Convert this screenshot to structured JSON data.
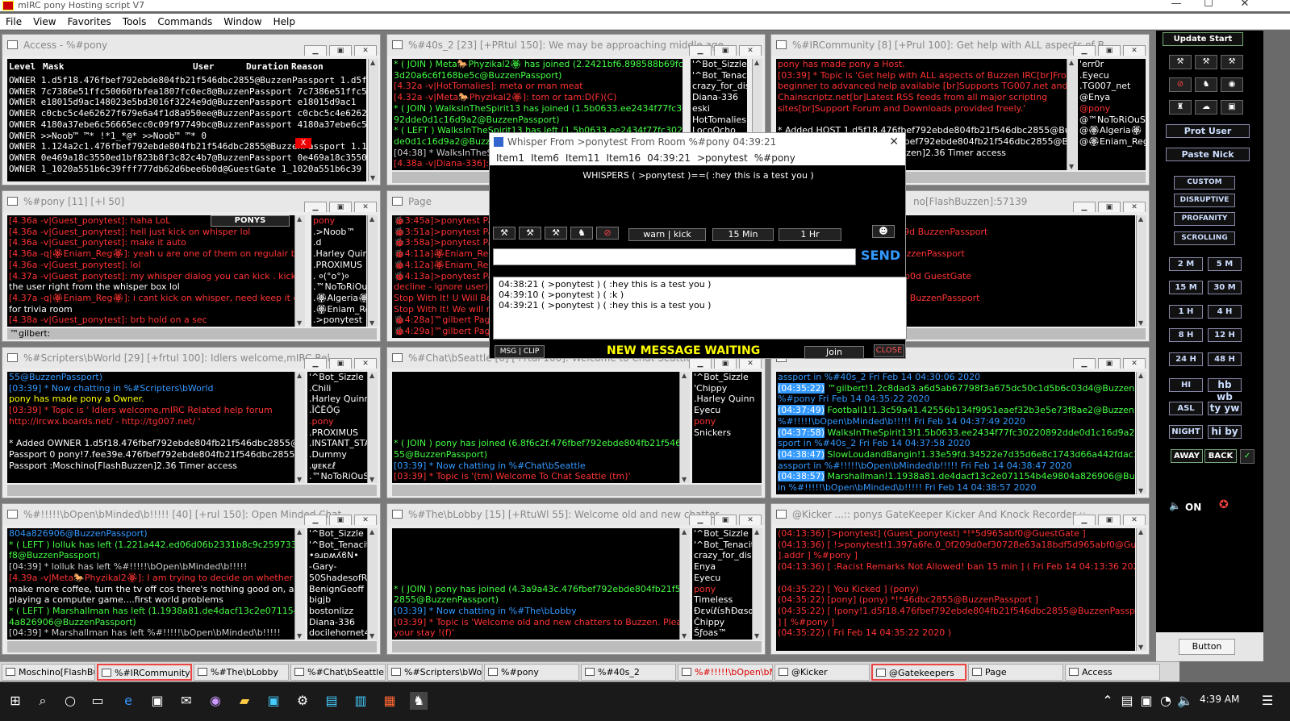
{
  "app": {
    "title": "mIRC pony Hosting script V7",
    "wc_min": "—",
    "wc_max": "☐",
    "wc_close": "✕"
  },
  "menu": [
    "File",
    "View",
    "Favorites",
    "Tools",
    "Commands",
    "Window",
    "Help"
  ],
  "access": {
    "title": "Access - %#pony",
    "headers": [
      "Level",
      "Mask",
      "User",
      "Duration",
      "Reason"
    ],
    "rows": [
      "OWNER  1.d5f18.476fbef792ebde804fb21f546dbc2855@BuzzenPassport 1.d5f18",
      "OWNER  7c7386e51ffc50060fbfea1807fc0ec8@BuzzenPassport 7c7386e51ffc50",
      "OWNER  e18015d9ac148023e5bd3016f3224e9d@BuzzenPassport e18015d9ac1",
      "OWNER  c0cbc5c4e62627f679e6a4f1d8a950ee@BuzzenPassport c0cbc5c4e62627",
      "OWNER  4180a37ebe6c56665ecc0c09f97749bc@BuzzenPassport 4180a37ebe6c5",
      "OWNER  >>Noob™     ™*  !*1_*@*       >>Noob™     ™*    0",
      "OWNER  1.124a2c1.476fbef792ebde804fb21f546dbc2855@BuzzenPassport 1.12",
      "OWNER  0e469a18c3550ed1bf823b8f3c82c4b7@BuzzenPassport 0e469a18c3550",
      "OWNER  1_1020a551b6c39fff777db62d6bee6b0d@GuestGate 1_1020a551b6c39"
    ],
    "x_badge": "X"
  },
  "w40s": {
    "title": "%#40s_2 [23] [+PRtul 150]: We may be approaching middle age...",
    "lines": [
      [
        "cg",
        "* ( JOIN ) Meta🐎Phyzikal2🏵 has joined (2.2421bf6.898588b69fc06fc3"
      ],
      [
        "cg",
        "3d20a6c6f168be5c@BuzzenPassport)"
      ],
      [
        "cr",
        "[4.32a -v|HotTomalies]: meta or man meat"
      ],
      [
        "cr",
        "[4.32a -v|Meta🐎Phyzikal2🏵]: tom or tam:D(F)(C)"
      ],
      [
        "cg",
        "* ( JOIN ) WalksInTheSpirit13 has joined (1.5b0633.ee2434f77fc302208"
      ],
      [
        "cg",
        "92dde0d1c16d9a2@BuzzenPassport)"
      ],
      [
        "cg",
        "* ( LEFT ) WalksInTheSpirit13 has left (1.5b0633.ee2434f77fc30220892"
      ],
      [
        "cg",
        "de0d1c16d9a2@BuzzenPassport)"
      ],
      [
        "cn",
        "[04:38] * WalksInTheSpi"
      ],
      [
        "cr",
        "[4.38a -v|Diana-336]: gi"
      ]
    ],
    "nicks": [
      "'^Bot_Sizzle",
      "'^Bot_Tenacity",
      "crazy_for_disn",
      "Diana-336",
      "eski",
      "HotTomalies",
      "LocoOcho"
    ]
  },
  "community": {
    "title": "%#IRCommunity [8] [+Prul 100]: Get help with ALL aspects of B...",
    "lines": [
      [
        "cr",
        "pony has made pony a Host."
      ],
      [
        "cr",
        "[03:39] * Topic is 'Get help with ALL aspects of Buzzen IRC[br]From"
      ],
      [
        "cr",
        "  beginner to advanced help available [br]Supports TG007.net and"
      ],
      [
        "cr",
        "  Chainscriptz.net[br]Latest RSS feeds from all major scripting"
      ],
      [
        "cr",
        "  sites[br]Support Forum and Downloads provided freely.'"
      ],
      [
        "cw",
        ""
      ],
      [
        "cw",
        "* Added HOST 1.d5f18.476fbef792ebde804fb21f546dbc2855@BuzzenPa"
      ],
      [
        "cw",
        "  ssport 0 pony!7.fee39e.476fbef792ebde804fb21f546dbc2855@Buzzen"
      ],
      [
        "cw",
        "  Passport :Moschino[FlashBuzzen]2.36 Timer access"
      ]
    ],
    "nicks": [
      "'err0r",
      ".Eyecu",
      ".TG007_net",
      "@Enya",
      "@pony",
      "@™NoToRiOuS™",
      "@🏵Algeria🏵",
      "@🏵Eniam_Reg🏵"
    ]
  },
  "pony": {
    "title": "%#pony [11] [+l 50]",
    "banner": "PONYS",
    "lines": [
      [
        "cr",
        "[4.36a -v|Guest_ponytest]: haha LoL"
      ],
      [
        "cr",
        "[4.36a -v|Guest_ponytest]: hell just kick on whisper lol"
      ],
      [
        "cr",
        "[4.36a -v|Guest_ponytest]: make it auto"
      ],
      [
        "cr",
        "[4.36a -q|🏵Eniam_Reg🏵]: yeah u are one of them on regulair basis"
      ],
      [
        "cr",
        "[4.36a -v|Guest_ponytest]: lol"
      ],
      [
        "cr",
        "[4.37a -v|Guest_ponytest]: my whisper dialog you can kick . kick ban , op"
      ],
      [
        "cw",
        "the user right from the whisper box lol"
      ],
      [
        "cr",
        "[4.37a -q|🏵Eniam_Reg🏵]: i cant kick on whisper, need keep it open"
      ],
      [
        "cw",
        "for trivia room"
      ],
      [
        "cr",
        "[4.38a -v|Guest_ponytest]: brb hold on a sec"
      ]
    ],
    "nicks": [
      "pony",
      ".>Noob™",
      ".d",
      ".Harley Quinn",
      ".PROXIMUS",
      ".  ०(°o°)०",
      ".™NoToRiOuS",
      ".🏵Algeria🏵",
      ".🏵Eniam_Reg",
      ".>ponytest"
    ],
    "input": "™gilbert:"
  },
  "page": {
    "title": "Page",
    "lines": [
      [
        "cr",
        "🐞3:45a]>ponytest Page"
      ],
      [
        "cr",
        "🐞3:51a]>ponytest Page"
      ],
      [
        "cr",
        "🐞3:58a]>ponytest Page"
      ],
      [
        "cr",
        "🐞4:11a]🏵Eniam_Reg🏵"
      ],
      [
        "cr",
        "🐞4:12a]🏵Eniam_Reg🏵"
      ],
      [
        "cr",
        "🐞4:13a]>ponytest Page"
      ],
      [
        "cr",
        "decline - ignore user). We"
      ],
      [
        "cr",
        "Stop With It! U Will Be Ban n"
      ],
      [
        "cr",
        "Stop With It! We will not"
      ],
      [
        "cr",
        "🐞4:28a]™gilbert Paged Y"
      ],
      [
        "cr",
        "🐞4:29a]™gilbert Paged Y"
      ]
    ]
  },
  "moschino": {
    "title": "no[FlashBuzzen]:57139",
    "lines": [
      [
        "cr",
        "IUS  H. 0 anon"
      ],
      [
        "cr",
        "8ac148023e5bd3016f3224e9d BuzzenPassport"
      ],
      [
        "cr",
        "™þ™©®   H. 0 Anon"
      ],
      [
        "cr",
        "ffc50060fbfea1807fc0ec8 BuzzenPassport"
      ],
      [
        "cr",
        "RiOuS™ H. 0 anon"
      ],
      [
        "cr",
        "551b6c39fff777db62d6bee6b0d GuestGate"
      ],
      [
        "cr",
        "™ H. 0 anon"
      ],
      [
        "cr",
        "e62627f679e6a4f1d8a950ee BuzzenPassport"
      ],
      [
        "cr",
        "Quinn H. 0 Anon"
      ]
    ]
  },
  "scripters": {
    "title": "%#Scripters\\bWorld [29] [+frtul 100]: Idlers welcome,mIRC Rel...",
    "lines": [
      [
        "cb",
        "55@BuzzenPassport)"
      ],
      [
        "cb",
        "[03:39] * Now chatting in %#Scripters\\bWorld"
      ],
      [
        "cy",
        "pony has made pony a Owner."
      ],
      [
        "cr",
        "[03:39] * Topic is ' Idlers welcome,mIRC Related help forum"
      ],
      [
        "cr",
        "   http://ircwx.boards.net/ - http://tg007.net/ '"
      ],
      [
        "cw",
        ""
      ],
      [
        "cw",
        "* Added OWNER 1.d5f18.476fbef792ebde804fb21f546dbc2855@Buzzen"
      ],
      [
        "cw",
        "Passport 0 pony!7.fee39e.476fbef792ebde804fb21f546dbc2855@Buzzen"
      ],
      [
        "cw",
        "Passport :Moschino[FlashBuzzen]2.36 Timer access"
      ]
    ],
    "nicks": [
      "'^Bot_Sizzle",
      ".Chili",
      ".Harley Quinn",
      ".ĪĈĒŐĢ",
      ".pony",
      ".PROXIMUS",
      ".INSTANT_STAR",
      ".Dummy",
      ".ψᴇκɛℓ",
      ".™NoToRiOuS"
    ]
  },
  "seattle": {
    "title": "%#Chat\\bSeattle [6] [+rtul 100]: Welcome to Chat Seattle",
    "lines": [
      [
        "cw",
        ""
      ],
      [
        "cw",
        ""
      ],
      [
        "cw",
        ""
      ],
      [
        "cw",
        ""
      ],
      [
        "cw",
        ""
      ],
      [
        "cw",
        ""
      ],
      [
        "cg",
        "* ( JOIN ) pony has joined (6.8f6c2f.476fbef792ebde804fb21f546dbc28"
      ],
      [
        "cg",
        "55@BuzzenPassport)"
      ],
      [
        "cb",
        "[03:39] * Now chatting in %#Chat\\bSeattle"
      ],
      [
        "cr",
        "[03:39] * Topic is '(tm) Welcome To Chat Seattle (tm)'"
      ]
    ],
    "nicks": [
      "'^Bot_Sizzle",
      "'Chippy",
      ".Harley Quinn",
      "Eyecu",
      "pony",
      "Snickers"
    ]
  },
  "log": {
    "lines": [
      [
        "cb",
        "assport in %#40s_2 Fri Feb 14 04:30:06 2020"
      ],
      [
        "ts",
        "(04:35:22)",
        "™gilbert!1.2c8dad3.a6d5ab67798f3a675dc50c1d5b6c03d4@BuzzenPassport in"
      ],
      [
        "cb",
        "%#pony Fri Feb 14 04:35:22 2020"
      ],
      [
        "ts",
        "(04:37:49)",
        "Football1!1.3c59a41.42556b134f9951eaef32b3e5e73f8ae2@BuzzenPassport in"
      ],
      [
        "cb",
        "%#!!!!!\\bOpen\\bMinded\\b!!!!! Fri Feb 14 04:37:49 2020"
      ],
      [
        "ts",
        "(04:37:58)",
        "WalksInTheSpirit13!1.5b0633.ee2434f77fc30220892dde0d1c16d9a2@BuzzenPas"
      ],
      [
        "cb",
        "sport in %#40s_2 Fri Feb 14 04:37:58 2020"
      ],
      [
        "ts",
        "(04:38:47)",
        "SlowLoudandBangin!1.33e59fd.34522e7d35d6e8c1743d66a442fdac15@BuzzenP"
      ],
      [
        "cb",
        "assport in %#!!!!!\\bOpen\\bMinded\\b!!!!! Fri Feb 14 04:38:47 2020"
      ],
      [
        "ts",
        "(04:38:57)",
        "Marshallman!1.1938a81.de4dacf13c2e071154b4e9804a826906@BuzzenPassport"
      ],
      [
        "cb",
        "in %#!!!!!\\bOpen\\bMinded\\b!!!!! Fri Feb 14 04:38:57 2020"
      ]
    ]
  },
  "openminded": {
    "title": "%#!!!!!\\bOpen\\bMinded\\b!!!!! [40] [+rul 150]: Open Minded Chat",
    "lines": [
      [
        "cb",
        "804a826906@BuzzenPassport)"
      ],
      [
        "cg",
        "* ( LEFT ) lolluk has left (1.221a442.ed06d06b2331b8c9c259733965a653"
      ],
      [
        "cg",
        "f8@BuzzenPassport)"
      ],
      [
        "cn",
        "[04:39] * lolluk has left %#!!!!!\\bOpen\\bMinded\\b!!!!!"
      ],
      [
        "cr",
        "[4.39a -v|Meta🐎Phyzikal2🏵]: I am trying to decide on whether to"
      ],
      [
        "cw",
        "make more coffee, turn the tv off cos there's nothing good on, and"
      ],
      [
        "cw",
        "playing a computer game....first world problems"
      ],
      [
        "cg",
        "* ( LEFT ) Marshallman has left (1.1938a81.de4dacf13c2e071154b4e980"
      ],
      [
        "cg",
        "4a826906@BuzzenPassport)"
      ],
      [
        "cn",
        "[04:39] * Marshallman has left %#!!!!!\\bOpen\\bMinded\\b!!!!!"
      ]
    ],
    "nicks": [
      "'^Bot_Sizzle",
      "'^Bot_Tenacity",
      "•ɘɹɒʍʎϐN•",
      "-Gary-",
      "50ShadesofRe",
      "BenignGeoff",
      "bigjb",
      "bostonlizz",
      "Diana-336",
      "docilehornet44"
    ]
  },
  "lobby": {
    "title": "%#The\\bLobby [15] [+RtuWl 55]: Welcome old and new chatter...",
    "lines": [
      [
        "cw",
        ""
      ],
      [
        "cw",
        ""
      ],
      [
        "cw",
        ""
      ],
      [
        "cw",
        ""
      ],
      [
        "cw",
        ""
      ],
      [
        "cg",
        "* ( JOIN ) pony has joined (4.3a9a43c.476fbef792ebde804fb21f546dbc"
      ],
      [
        "cg",
        "2855@BuzzenPassport)"
      ],
      [
        "cb",
        "[03:39] * Now chatting in %#The\\bLobby"
      ],
      [
        "cr",
        "[03:39] * Topic is 'Welcome old and new chatters to Buzzen. Please enjoy"
      ],
      [
        "cr",
        "  your stay !(f)'"
      ]
    ],
    "nicks": [
      "'^Bot_Sizzle",
      "'^Bot_Tenacity",
      "crazy_for_disn",
      "Enya",
      "Eyecu",
      "pony",
      "Timeless",
      "ĐενίℓίѕħĐαѕαм",
      "Ĉhippy",
      "Šƒoas™"
    ]
  },
  "kicker": {
    "title": "@Kicker ...:: ponys GateKeeper Kicker And Knock Recorder ::...",
    "lines": [
      [
        "cr",
        "(04:13:36) [>ponytest] (Guest_ponytest) *!*5d965abf0@GuestGate ]"
      ],
      [
        "cr",
        "(04:13:36) [ !>ponytest!1.397a6fe.0_0f209d0ef30728e63a18bdf5d965abf0@GuestGate"
      ],
      [
        "cr",
        "].addr ] %#pony ]"
      ],
      [
        "cr",
        "(04:13:36) [ :Racist Remarks Not Allowed! ban 15 min ] ( Fri Feb 14 04:13:36 2020 )"
      ],
      [
        "cw",
        ""
      ],
      [
        "cr",
        "(04:35:22) [ You Kicked ] (pony)"
      ],
      [
        "cr",
        "(04:35:22) [pony] (pony) *!*46dbc2855@BuzzenPassport ]"
      ],
      [
        "cr",
        "(04:35:22) [ !pony!1.d5f18.476fbef792ebde804fb21f546dbc2855@BuzzenPassport ].addr"
      ],
      [
        "cr",
        "] [ %#pony ]"
      ],
      [
        "cr",
        "(04:35:22) ( Fri Feb 14 04:35:22 2020 )"
      ]
    ]
  },
  "whisper": {
    "title": "Whisper From >ponytest From Room %#pony 04:39:21",
    "close": "✕",
    "menu": [
      "Item1",
      "Item6",
      "Item11",
      "Item16",
      "04:39:21",
      ">ponytest",
      "%#pony"
    ],
    "header": "WHISPERS ( >ponytest )==( :hey this is a test you )",
    "btn_warn": "warn | kick",
    "btn_15": "15 Min",
    "btn_1h": "1 Hr",
    "send": "SEND",
    "msgs": [
      "04:38:21 ( >ponytest ) ( :hey this is a test you )",
      "04:39:10 ( >ponytest ) ( :k )",
      "04:39:21 ( >ponytest ) ( :hey this is a test you )"
    ],
    "msg": "MSG",
    "clip": "CLIP",
    "status": "NEW MESSAGE WAITING",
    "join": "Join",
    "closebtn": "CLOSE"
  },
  "sidebar": {
    "update": "Update Start",
    "protuser": "Prot User",
    "pastenick": "Paste Nick",
    "custom": "CUSTOM",
    "disruptive": "DISRUPTIVE",
    "profanity": "PROFANITY",
    "scrolling": "SCROLLING",
    "times": [
      "2 M",
      "5 M",
      "15 M",
      "30 M",
      "1 H",
      "4 H",
      "8 H",
      "12 H",
      "24 H",
      "48 H"
    ],
    "greet": [
      "HI",
      "hb wb",
      "ASL",
      "ty yw",
      "NIGHT",
      "hi by"
    ],
    "away": "AWAY",
    "back": "BACK",
    "on": "ON",
    "button": "Button"
  },
  "tabs": [
    "Moschino[FlashBu...",
    "%#IRCommunity",
    "%#The\\bLobby",
    "%#Chat\\bSeattle",
    "%#Scripters\\bWorld",
    "%#pony",
    "%#40s_2",
    "%#!!!!!\\bOpen\\bM...",
    "@Kicker",
    "@Gatekeepers",
    "Page",
    "Access"
  ],
  "tray": {
    "time": "4:39 AM"
  }
}
